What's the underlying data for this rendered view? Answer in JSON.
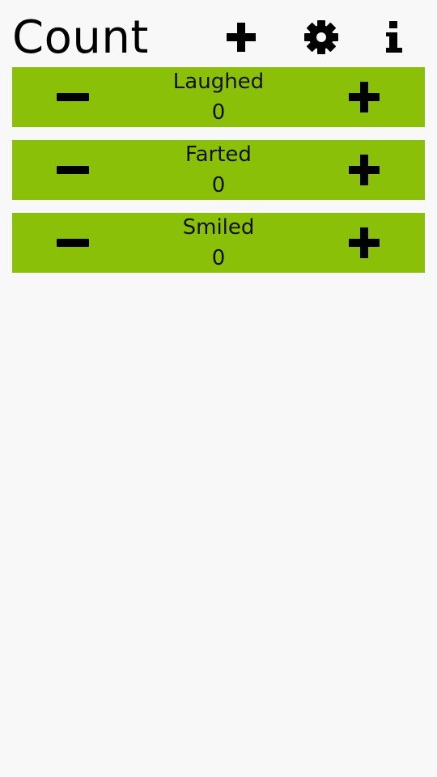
{
  "app": {
    "title": "Count",
    "accent_color": "#8bc008",
    "background_color": "#f8f8f8"
  },
  "toolbar": {
    "add_icon": "plus-icon",
    "settings_icon": "gear-icon",
    "info_icon": "info-icon"
  },
  "counters": [
    {
      "label": "Laughed",
      "count": "0"
    },
    {
      "label": "Farted",
      "count": "0"
    },
    {
      "label": "Smiled",
      "count": "0"
    }
  ]
}
